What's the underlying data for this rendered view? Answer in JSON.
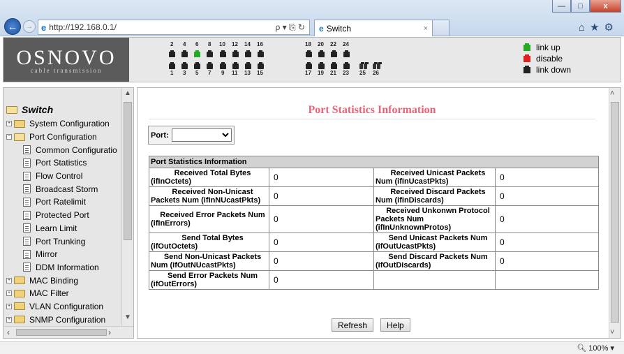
{
  "browser": {
    "url": "http://192.168.0.1/",
    "search_glyph": "ρ ▾ ⎘ ↻",
    "tab_title": "Switch",
    "tab_close": "×",
    "zoom": "100%",
    "back": "←",
    "forward": "→",
    "tools": "⌂★⚙",
    "window_controls": [
      "—",
      "□",
      "x"
    ]
  },
  "header": {
    "brand": "OSNOVO",
    "tagline": "cable transmission",
    "ports_top": [
      "2",
      "4",
      "6",
      "8",
      "10",
      "12",
      "14",
      "16",
      "18",
      "20",
      "22",
      "24"
    ],
    "ports_bottom": [
      "1",
      "3",
      "5",
      "7",
      "9",
      "11",
      "13",
      "15",
      "17",
      "19",
      "21",
      "23"
    ],
    "fiber_labels": [
      "25",
      "26"
    ],
    "ports_up": [
      "6"
    ],
    "legend": [
      {
        "label": "link up",
        "color": "#22aa22"
      },
      {
        "label": "disable",
        "color": "#dd2222"
      },
      {
        "label": "link down",
        "color": "#222222"
      }
    ]
  },
  "sidebar": {
    "root": "Switch",
    "items": [
      {
        "label": "System Configuration",
        "type": "folder"
      },
      {
        "label": "Port Configuration",
        "type": "folder-open"
      },
      {
        "label": "Common Configuratio",
        "type": "page"
      },
      {
        "label": "Port Statistics",
        "type": "page"
      },
      {
        "label": "Flow Control",
        "type": "page"
      },
      {
        "label": "Broadcast Storm",
        "type": "page"
      },
      {
        "label": "Port Ratelimit",
        "type": "page"
      },
      {
        "label": "Protected Port",
        "type": "page"
      },
      {
        "label": "Learn Limit",
        "type": "page"
      },
      {
        "label": "Port Trunking",
        "type": "page"
      },
      {
        "label": "Mirror",
        "type": "page"
      },
      {
        "label": "DDM Information",
        "type": "page"
      },
      {
        "label": "MAC Binding",
        "type": "folder"
      },
      {
        "label": "MAC Filter",
        "type": "folder"
      },
      {
        "label": "VLAN Configuration",
        "type": "folder"
      },
      {
        "label": "SNMP Configuration",
        "type": "folder"
      }
    ]
  },
  "main": {
    "title": "Port Statistics Information",
    "port_label": "Port:",
    "port_value": "",
    "table_header": "Port Statistics Information",
    "rows": [
      [
        {
          "t": "Received Total Bytes",
          "s": "(ifInOctets)",
          "v": "0"
        },
        {
          "t": "Received Unicast Packets",
          "s": "Num (ifInUcastPkts)",
          "v": "0"
        }
      ],
      [
        {
          "t": "Received Non-Unicast",
          "s": "Packets Num (ifInNUcastPkts)",
          "v": "0"
        },
        {
          "t": "Received Discard Packets",
          "s": "Num (ifInDiscards)",
          "v": "0"
        }
      ],
      [
        {
          "t": "Received Error Packets Num",
          "s": "(ifInErrors)",
          "v": "0"
        },
        {
          "t": "Received Unkonwn Protocol",
          "s": "Packets Num (ifInUnknownProtos)",
          "v": "0"
        }
      ],
      [
        {
          "t": "Send Total Bytes",
          "s": "(ifOutOctets)",
          "v": "0"
        },
        {
          "t": "Send Unicast Packets Num",
          "s": "(ifOutUcastPkts)",
          "v": "0"
        }
      ],
      [
        {
          "t": "Send Non-Unicast Packets",
          "s": "Num (ifOutNUcastPkts)",
          "v": "0"
        },
        {
          "t": "Send Discard Packets Num",
          "s": "(ifOutDiscards)",
          "v": "0"
        }
      ],
      [
        {
          "t": "Send Error Packets Num",
          "s": "(ifOutErrors)",
          "v": "0"
        },
        {
          "t": "",
          "s": "",
          "v": ""
        }
      ]
    ],
    "refresh": "Refresh",
    "help": "Help"
  }
}
